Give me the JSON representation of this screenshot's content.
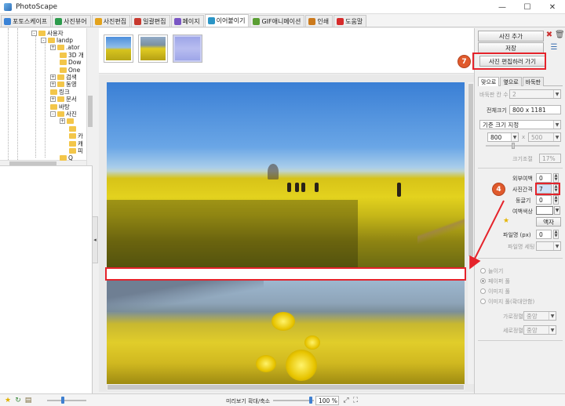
{
  "window": {
    "title": "PhotoScape",
    "minimize": "—",
    "maximize": "☐",
    "close": "✕"
  },
  "tabs": [
    {
      "label": "포토스케이프",
      "color": "#3b83d6"
    },
    {
      "label": "사진뷰어",
      "color": "#2d9b4c"
    },
    {
      "label": "사진편집",
      "color": "#e3a21c"
    },
    {
      "label": "일괄편집",
      "color": "#c8392f"
    },
    {
      "label": "페이지",
      "color": "#7a56c4"
    },
    {
      "label": "이어붙이기",
      "color": "#2b95c6"
    },
    {
      "label": "GIF애니메이션",
      "color": "#5a9e33"
    },
    {
      "label": "인쇄",
      "color": "#cc7a1c"
    },
    {
      "label": "도움말",
      "color": "#d62b2b"
    }
  ],
  "tree": {
    "items": [
      {
        "label": "사용자",
        "expander": "-"
      },
      {
        "label": "landp",
        "expander": "-"
      },
      {
        "label": ".ator",
        "expander": "+"
      },
      {
        "label": "3D 개",
        "expander": ""
      },
      {
        "label": "Dow",
        "expander": ""
      },
      {
        "label": "One",
        "expander": ""
      },
      {
        "label": "검색",
        "expander": "+"
      },
      {
        "label": "동영",
        "expander": "+"
      },
      {
        "label": "링크",
        "expander": ""
      },
      {
        "label": "문서",
        "expander": "+"
      },
      {
        "label": "바탕",
        "expander": ""
      },
      {
        "label": "사진",
        "expander": "-"
      },
      {
        "label": "",
        "expander": "+"
      },
      {
        "label": "",
        "expander": ""
      },
      {
        "label": "카",
        "expander": ""
      },
      {
        "label": "캐",
        "expander": ""
      },
      {
        "label": "피",
        "expander": ""
      },
      {
        "label": "Q",
        "expander": ""
      }
    ]
  },
  "thumbnails": [
    {
      "name": "field-thumb-1",
      "color": "#d6c31d"
    },
    {
      "name": "field-thumb-2",
      "color": "#e1cc22"
    },
    {
      "name": "field-thumb-3",
      "color": "#9ea6e8"
    }
  ],
  "right_panel": {
    "add_photo": "사진 추가",
    "save": "저장",
    "go_edit": "사진 편집하러 가기",
    "step7_badge": "7",
    "step4_badge": "4",
    "tabs": [
      "맞으로",
      "옆으로",
      "바둑판"
    ],
    "grid_count_label": "바둑판 칸 수",
    "grid_count_value": "2",
    "total_size_label": "전체크기",
    "total_size_value": "800 x 1181",
    "base_size_option": "기준 크기 지정",
    "width_value": "800",
    "height_value": "500",
    "scale_label": "크기조절",
    "scale_value": "17%",
    "outer_margin_label": "외부여백",
    "outer_margin_value": "0",
    "photo_gap_label": "사진간격",
    "photo_gap_value": "7",
    "rounding_label": "둥글기",
    "rounding_value": "0",
    "margin_color_label": "여백색상",
    "margin_color_value": "#ffffff",
    "frame_button": "액자",
    "filesize_label": "파일명 (px)",
    "filesize_value": "0",
    "filename_setting_label": "파일명 세팅",
    "radio_options": [
      "늘이기",
      "페이퍼 풀",
      "이미지 풀",
      "이미지 풀(확대안함)"
    ],
    "horizontal_align_label": "가로정렬",
    "horizontal_align_value": "중앙",
    "vertical_align_label": "세로정렬",
    "vertical_align_value": "중앙"
  },
  "statusbar": {
    "zoom_label": "미리보기 확대/축소",
    "zoom_value": "100 %"
  },
  "colors": {
    "highlight": "#e5232b",
    "badge": "#e05a2c"
  }
}
